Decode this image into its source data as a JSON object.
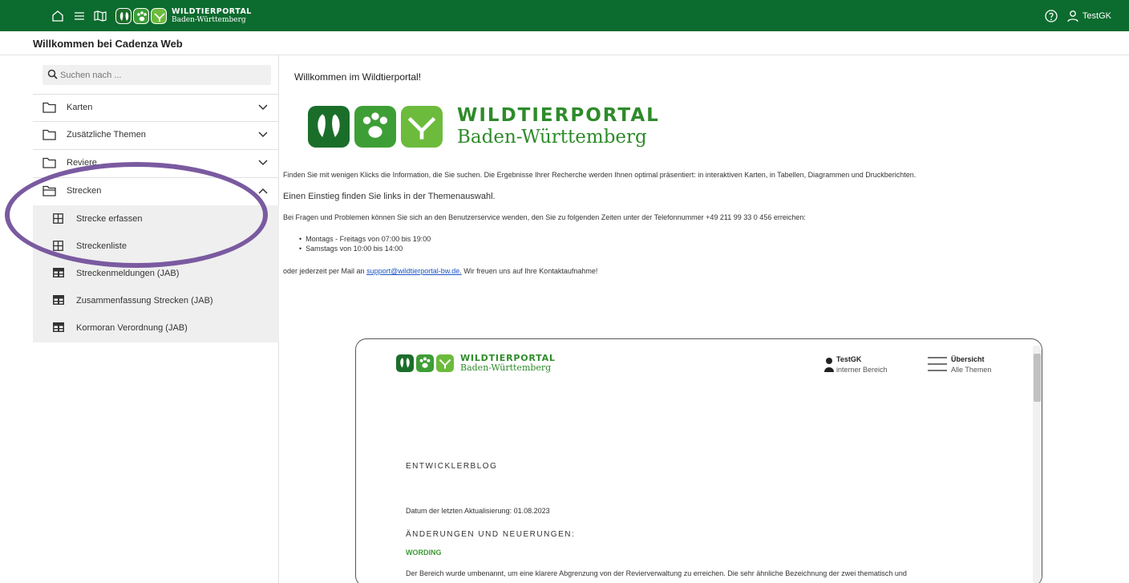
{
  "topbar": {
    "logo_line1": "WILDTIERPORTAL",
    "logo_line2": "Baden-Württemberg",
    "user": "TestGK",
    "bg_color": "#0c6b2e"
  },
  "subheader": {
    "title": "Willkommen bei Cadenza Web"
  },
  "sidebar": {
    "search_placeholder": "Suchen nach ...",
    "folders": [
      {
        "label": "Karten",
        "icon": "folder-icon",
        "expanded": false
      },
      {
        "label": "Zusätzliche Themen",
        "icon": "folder-icon",
        "expanded": false
      },
      {
        "label": "Reviere",
        "icon": "folder-icon",
        "expanded": false
      },
      {
        "label": "Strecken",
        "icon": "folder-open-icon",
        "expanded": true
      }
    ],
    "strecken_items": [
      {
        "label": "Strecke erfassen",
        "icon": "form-icon"
      },
      {
        "label": "Streckenliste",
        "icon": "form-icon"
      },
      {
        "label": "Streckenmeldungen (JAB)",
        "icon": "table-icon"
      },
      {
        "label": "Zusammenfassung Strecken (JAB)",
        "icon": "table-icon"
      },
      {
        "label": "Kormoran Verordnung (JAB)",
        "icon": "table-icon"
      }
    ]
  },
  "main": {
    "welcome": "Willkommen im Wildtierportal!",
    "logo_line1": "WILDTIERPORTAL",
    "logo_line2": "Baden-Württemberg",
    "para1": "Finden Sie mit wenigen Klicks die Information, die Sie suchen. Die Ergebnisse Ihrer Recherche werden Ihnen optimal präsentiert: in interaktiven Karten, in Tabellen, Diagrammen und Druckberichten.",
    "para2": "Einen Einstieg finden Sie links in der Themenauswahl.",
    "para3": "Bei Fragen und Problemen können Sie sich an den Benutzerservice wenden, den Sie zu folgenden Zeiten unter der Telefonnummer +49 211 99 33 0 456 erreichen:",
    "hours": [
      "Montags - Freitags von 07:00 bis 19:00",
      "Samstags von 10:00 bis 14:00"
    ],
    "mail_prefix": "oder jederzeit per Mail an ",
    "mail_link": "support@wildtierportal-bw.de.",
    "mail_suffix": " Wir freuen uns auf Ihre Kontaktaufnahme!"
  },
  "frame": {
    "logo_line1": "WILDTIERPORTAL",
    "logo_line2": "Baden-Württemberg",
    "user_name": "TestGK",
    "user_sub": "interner Bereich",
    "menu_title": "Übersicht",
    "menu_sub": "Alle Themen",
    "blog_heading": "ENTWICKLERBLOG",
    "date_text": "Datum der letzten Aktualisierung: 01.08.2023",
    "changes_heading": "ÄNDERUNGEN UND NEUERUNGEN:",
    "section_title": "WORDING",
    "body_text": "Der Bereich wurde umbenannt, um eine klarere Abgrenzung von der Revierverwaltung zu erreichen. Die sehr ähnliche Bezeichnung der zwei thematisch und"
  },
  "colors": {
    "tile_dark": "#1b6e2a",
    "tile_mid": "#3e9e36",
    "tile_light": "#6cbb3c",
    "annotation": "#7a5aa0"
  }
}
